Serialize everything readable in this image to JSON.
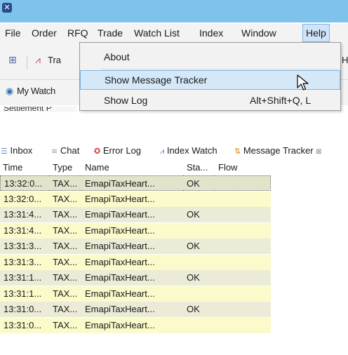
{
  "window": {
    "app_icon": "app-logo-icon",
    "titlebar_color": "#7fc3ec"
  },
  "menubar": {
    "items": [
      "File",
      "Order",
      "RFQ",
      "Trade",
      "Watch List",
      "Index",
      "Window",
      "Help"
    ],
    "active": "Help"
  },
  "toolbar": {
    "label_clipped": "Tra",
    "overflow_letter": "H"
  },
  "watch_tab": {
    "label": "My Watch",
    "settlement_clipped": "Settlement P"
  },
  "help_menu": {
    "items": [
      {
        "label": "About",
        "shortcut": ""
      },
      {
        "label": "Show Message Tracker",
        "shortcut": "",
        "highlighted": true
      },
      {
        "label": "Show Log",
        "shortcut": "Alt+Shift+Q, L"
      }
    ]
  },
  "views": {
    "tabs": [
      {
        "label": "Inbox",
        "icon": "inbox-icon"
      },
      {
        "label": "Chat",
        "icon": "chat-icon"
      },
      {
        "label": "Error Log",
        "icon": "error-log-icon"
      },
      {
        "label": "Index Watch",
        "icon": "index-watch-icon"
      },
      {
        "label": "Message Tracker",
        "icon": "message-tracker-icon",
        "active": true
      }
    ],
    "close_glyph": "⊠"
  },
  "tracker_table": {
    "columns": [
      "Time",
      "Type",
      "Name",
      "Sta...",
      "Flow"
    ],
    "rows": [
      {
        "time": "13:32:0...",
        "type": "TAX...",
        "name": "EmapiTaxHeart...",
        "status": "OK",
        "flow": ""
      },
      {
        "time": "13:32:0...",
        "type": "TAX...",
        "name": "EmapiTaxHeart...",
        "status": "",
        "flow": ""
      },
      {
        "time": "13:31:4...",
        "type": "TAX...",
        "name": "EmapiTaxHeart...",
        "status": "OK",
        "flow": ""
      },
      {
        "time": "13:31:4...",
        "type": "TAX...",
        "name": "EmapiTaxHeart...",
        "status": "",
        "flow": ""
      },
      {
        "time": "13:31:3...",
        "type": "TAX...",
        "name": "EmapiTaxHeart...",
        "status": "OK",
        "flow": ""
      },
      {
        "time": "13:31:3...",
        "type": "TAX...",
        "name": "EmapiTaxHeart...",
        "status": "",
        "flow": ""
      },
      {
        "time": "13:31:1...",
        "type": "TAX...",
        "name": "EmapiTaxHeart...",
        "status": "OK",
        "flow": ""
      },
      {
        "time": "13:31:1...",
        "type": "TAX...",
        "name": "EmapiTaxHeart...",
        "status": "",
        "flow": ""
      },
      {
        "time": "13:31:0...",
        "type": "TAX...",
        "name": "EmapiTaxHeart...",
        "status": "OK",
        "flow": ""
      },
      {
        "time": "13:31:0...",
        "type": "TAX...",
        "name": "EmapiTaxHeart...",
        "status": "",
        "flow": ""
      }
    ],
    "colors": {
      "ok_row": "#ebebd7",
      "pending_row": "#fbfacb",
      "selected_row": "#e3e3cc"
    }
  }
}
